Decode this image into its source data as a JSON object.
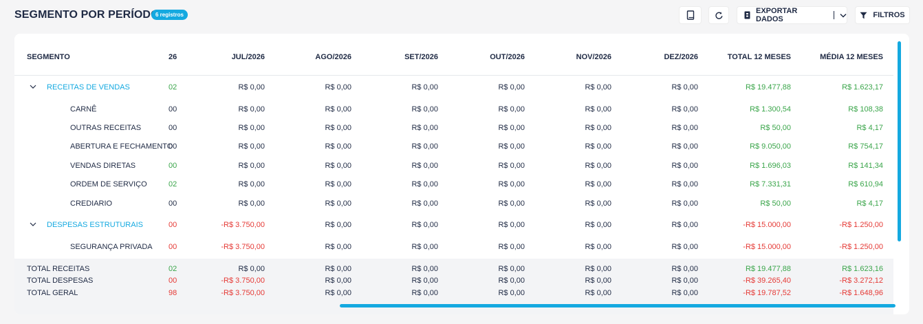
{
  "page": {
    "title": "SEGMENTO POR PERÍODO",
    "badge": "6 registros"
  },
  "toolbar": {
    "book_icon": "book-icon",
    "refresh_icon": "refresh-icon",
    "export_label": "EXPORTAR DADOS",
    "filter_label": "FILTROS"
  },
  "colors": {
    "accent": "#14a9e0",
    "positive": "#3aa54a",
    "negative": "#e53935",
    "text": "#1f2a44"
  },
  "table": {
    "headers": {
      "segmento": "SEGMENTO",
      "col26": "26",
      "jul": "JUL/2026",
      "ago": "AGO/2026",
      "set": "SET/2026",
      "out": "OUT/2026",
      "nov": "NOV/2026",
      "dez": "DEZ/2026",
      "total": "TOTAL 12 MESES",
      "media": "MÉDIA 12 MESES"
    },
    "rows": [
      {
        "type": "group",
        "segmento": "RECEITAS DE VENDAS",
        "col26": "02",
        "col26_color": "green",
        "jul": "R$ 0,00",
        "ago": "R$ 0,00",
        "set": "R$ 0,00",
        "out": "R$ 0,00",
        "nov": "R$ 0,00",
        "dez": "R$ 0,00",
        "total": "R$ 19.477,88",
        "media": "R$ 1.623,17",
        "tone": "green"
      },
      {
        "type": "child",
        "segmento": "CARNÊ",
        "col26": "00",
        "col26_color": "dark",
        "jul": "R$ 0,00",
        "ago": "R$ 0,00",
        "set": "R$ 0,00",
        "out": "R$ 0,00",
        "nov": "R$ 0,00",
        "dez": "R$ 0,00",
        "total": "R$ 1.300,54",
        "media": "R$ 108,38",
        "tone": "green"
      },
      {
        "type": "child",
        "segmento": "OUTRAS RECEITAS",
        "col26": "00",
        "col26_color": "dark",
        "jul": "R$ 0,00",
        "ago": "R$ 0,00",
        "set": "R$ 0,00",
        "out": "R$ 0,00",
        "nov": "R$ 0,00",
        "dez": "R$ 0,00",
        "total": "R$ 50,00",
        "media": "R$ 4,17",
        "tone": "green"
      },
      {
        "type": "child",
        "segmento": "ABERTURA E FECHAMENTO",
        "col26": "00",
        "col26_color": "dark",
        "jul": "R$ 0,00",
        "ago": "R$ 0,00",
        "set": "R$ 0,00",
        "out": "R$ 0,00",
        "nov": "R$ 0,00",
        "dez": "R$ 0,00",
        "total": "R$ 9.050,00",
        "media": "R$ 754,17",
        "tone": "green"
      },
      {
        "type": "child",
        "segmento": "VENDAS DIRETAS",
        "col26": "00",
        "col26_color": "green",
        "jul": "R$ 0,00",
        "ago": "R$ 0,00",
        "set": "R$ 0,00",
        "out": "R$ 0,00",
        "nov": "R$ 0,00",
        "dez": "R$ 0,00",
        "total": "R$ 1.696,03",
        "media": "R$ 141,34",
        "tone": "green"
      },
      {
        "type": "child",
        "segmento": "ORDEM DE SERVIÇO",
        "col26": "02",
        "col26_color": "green",
        "jul": "R$ 0,00",
        "ago": "R$ 0,00",
        "set": "R$ 0,00",
        "out": "R$ 0,00",
        "nov": "R$ 0,00",
        "dez": "R$ 0,00",
        "total": "R$ 7.331,31",
        "media": "R$ 610,94",
        "tone": "green"
      },
      {
        "type": "child",
        "segmento": "CREDIARIO",
        "col26": "00",
        "col26_color": "dark",
        "jul": "R$ 0,00",
        "ago": "R$ 0,00",
        "set": "R$ 0,00",
        "out": "R$ 0,00",
        "nov": "R$ 0,00",
        "dez": "R$ 0,00",
        "total": "R$ 50,00",
        "media": "R$ 4,17",
        "tone": "green"
      },
      {
        "type": "group",
        "segmento": "DESPESAS ESTRUTURAIS",
        "col26": "00",
        "col26_color": "red",
        "jul": "-R$ 3.750,00",
        "ago": "R$ 0,00",
        "set": "R$ 0,00",
        "out": "R$ 0,00",
        "nov": "R$ 0,00",
        "dez": "R$ 0,00",
        "total": "-R$ 15.000,00",
        "media": "-R$ 1.250,00",
        "tone": "red"
      },
      {
        "type": "child",
        "segmento": "SEGURANÇA PRIVADA",
        "col26": "00",
        "col26_color": "red",
        "jul": "-R$ 3.750,00",
        "ago": "R$ 0,00",
        "set": "R$ 0,00",
        "out": "R$ 0,00",
        "nov": "R$ 0,00",
        "dez": "R$ 0,00",
        "total": "-R$ 15.000,00",
        "media": "-R$ 1.250,00",
        "tone": "red"
      }
    ],
    "totals": [
      {
        "segmento": "TOTAL RECEITAS",
        "col26": "02",
        "col26_color": "green",
        "jul": "R$ 0,00",
        "ago": "R$ 0,00",
        "set": "R$ 0,00",
        "out": "R$ 0,00",
        "nov": "R$ 0,00",
        "dez": "R$ 0,00",
        "total": "R$ 19.477,88",
        "media": "R$ 1.623,16",
        "tone": "green"
      },
      {
        "segmento": "TOTAL DESPESAS",
        "col26": "00",
        "col26_color": "red",
        "jul": "-R$ 3.750,00",
        "ago": "R$ 0,00",
        "set": "R$ 0,00",
        "out": "R$ 0,00",
        "nov": "R$ 0,00",
        "dez": "R$ 0,00",
        "total": "-R$ 39.265,40",
        "media": "-R$ 3.272,12",
        "tone": "red"
      },
      {
        "segmento": "TOTAL GERAL",
        "col26": "98",
        "col26_color": "red",
        "jul": "-R$ 3.750,00",
        "ago": "R$ 0,00",
        "set": "R$ 0,00",
        "out": "R$ 0,00",
        "nov": "R$ 0,00",
        "dez": "R$ 0,00",
        "total": "-R$ 19.787,52",
        "media": "-R$ 1.648,96",
        "tone": "red"
      }
    ]
  }
}
